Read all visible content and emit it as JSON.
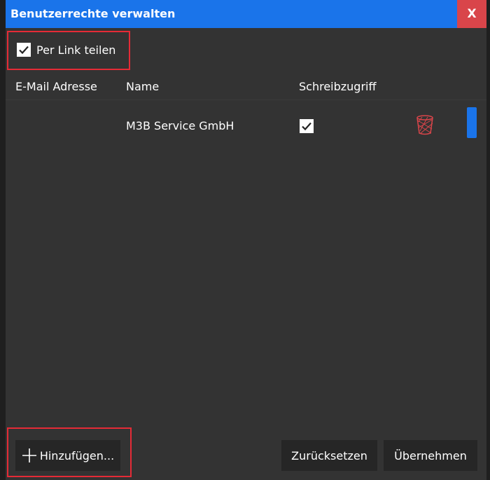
{
  "dialog": {
    "title": "Benutzerrechte verwalten",
    "close_label": "X"
  },
  "share": {
    "label": "Per Link teilen",
    "checked": true
  },
  "table": {
    "headers": [
      "E-Mail Adresse",
      "Name",
      "Schreibzugriff"
    ],
    "rows": [
      {
        "email": "",
        "name": "M3B Service GmbH",
        "write_access": true
      }
    ]
  },
  "buttons": {
    "add": "Hinzufügen...",
    "reset": "Zurücksetzen",
    "apply": "Übernehmen"
  },
  "colors": {
    "accent": "#1a74ea",
    "close": "#d9454a",
    "highlight": "#e52b36",
    "trash": "#d9454a"
  }
}
